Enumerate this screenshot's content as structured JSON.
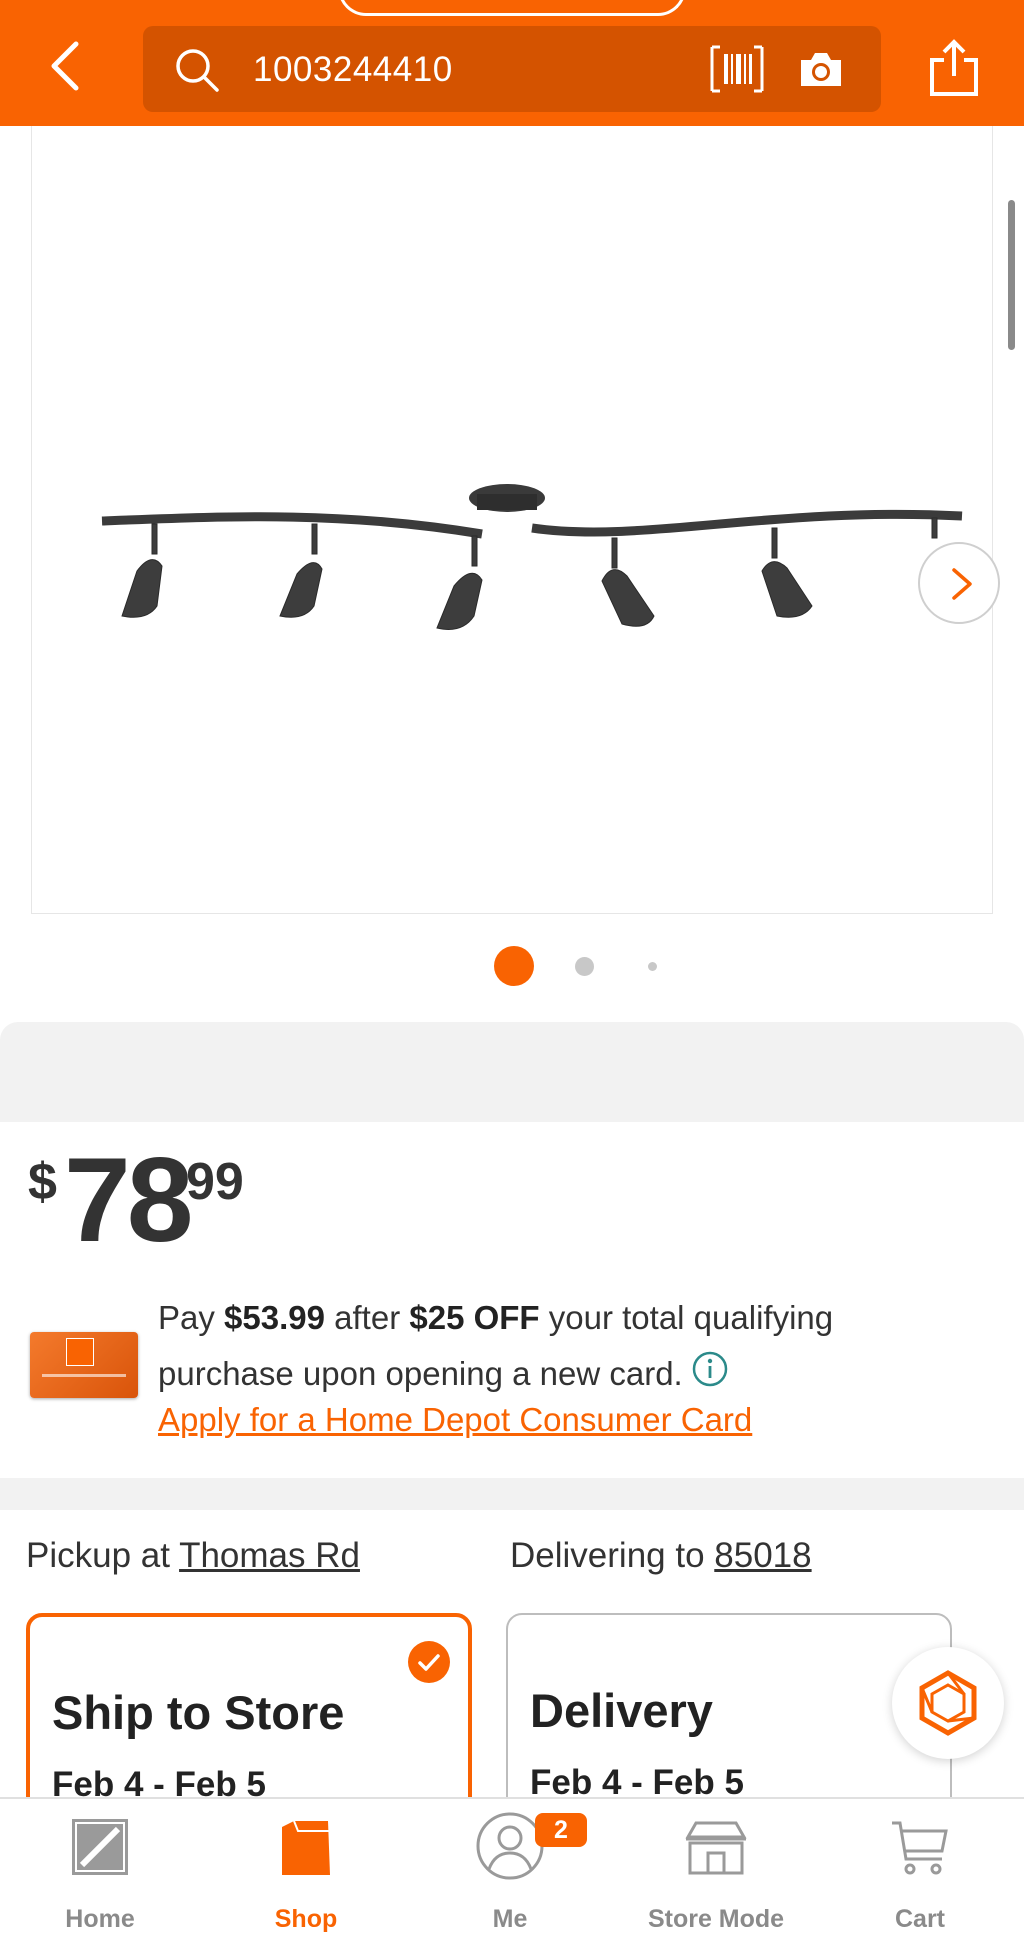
{
  "header": {
    "search_value": "1003244410",
    "icons": [
      "back-icon",
      "search-icon",
      "barcode-icon",
      "camera-icon",
      "share-icon"
    ]
  },
  "gallery": {
    "image_alt": "track lighting fixture with six spotlights",
    "slide_count": 3,
    "active_slide": 1
  },
  "price": {
    "currency": "$",
    "dollars": "78",
    "cents": "99"
  },
  "offer": {
    "pay_prefix": "Pay",
    "pay_amount": "$53.99",
    "after": "after",
    "discount": "$25 OFF",
    "line1_rest": "your total qualifying",
    "line2": "purchase upon opening a new card.",
    "apply_link": "Apply for a Home Depot Consumer Card"
  },
  "fulfillment": {
    "pickup_prefix": "Pickup at",
    "pickup_store": "Thomas Rd",
    "deliver_prefix": "Delivering to",
    "deliver_zip": "85018",
    "options": [
      {
        "title": "Ship to Store",
        "dates": "Feb 4 - Feb 5",
        "selected": true
      },
      {
        "title": "Delivery",
        "dates": "Feb 4 - Feb 5",
        "selected": false
      }
    ]
  },
  "bottom_nav": {
    "items": [
      {
        "label": "Home",
        "icon": "home-depot-logo-icon"
      },
      {
        "label": "Shop",
        "icon": "shop-bag-icon",
        "active": true
      },
      {
        "label": "Me",
        "icon": "user-icon",
        "badge": "2"
      },
      {
        "label": "Store Mode",
        "icon": "store-icon"
      },
      {
        "label": "Cart",
        "icon": "cart-icon"
      }
    ]
  },
  "colors": {
    "brand": "#f96302",
    "search_bg": "#d45300",
    "muted": "#8a8a8a"
  }
}
